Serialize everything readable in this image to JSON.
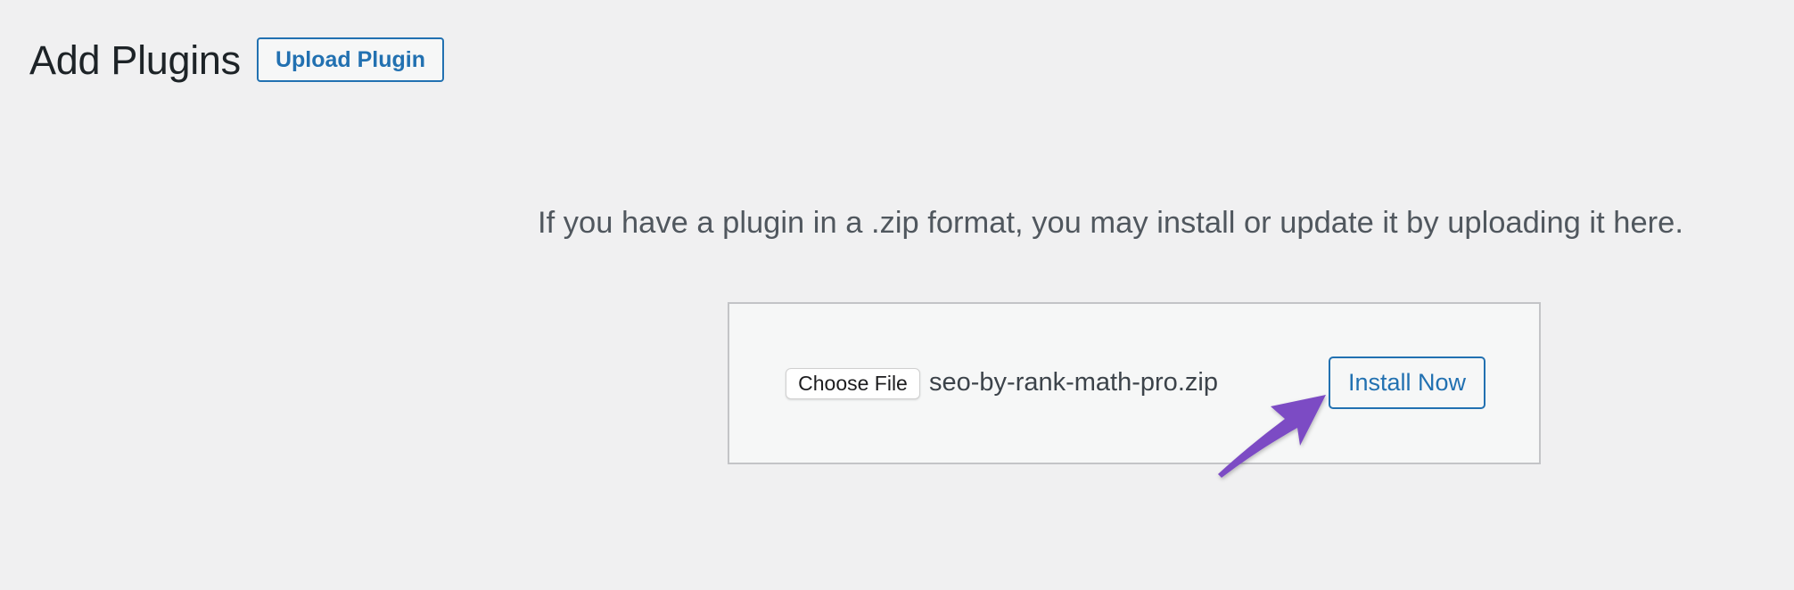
{
  "header": {
    "title": "Add Plugins",
    "upload_button_label": "Upload Plugin"
  },
  "upload": {
    "description": "If you have a plugin in a .zip format, you may install or update it by uploading it here.",
    "choose_file_label": "Choose File",
    "selected_file": "seo-by-rank-math-pro.zip",
    "install_button_label": "Install Now"
  },
  "annotation": {
    "arrow_icon": "arrow-pointing-to-install-now",
    "arrow_color": "#7b4bc4"
  },
  "colors": {
    "accent": "#2271b1",
    "background": "#f0f0f1",
    "box_background": "#f6f7f7",
    "box_border": "#c3c4c7",
    "title_text": "#1d2327",
    "body_text": "#50575e"
  }
}
